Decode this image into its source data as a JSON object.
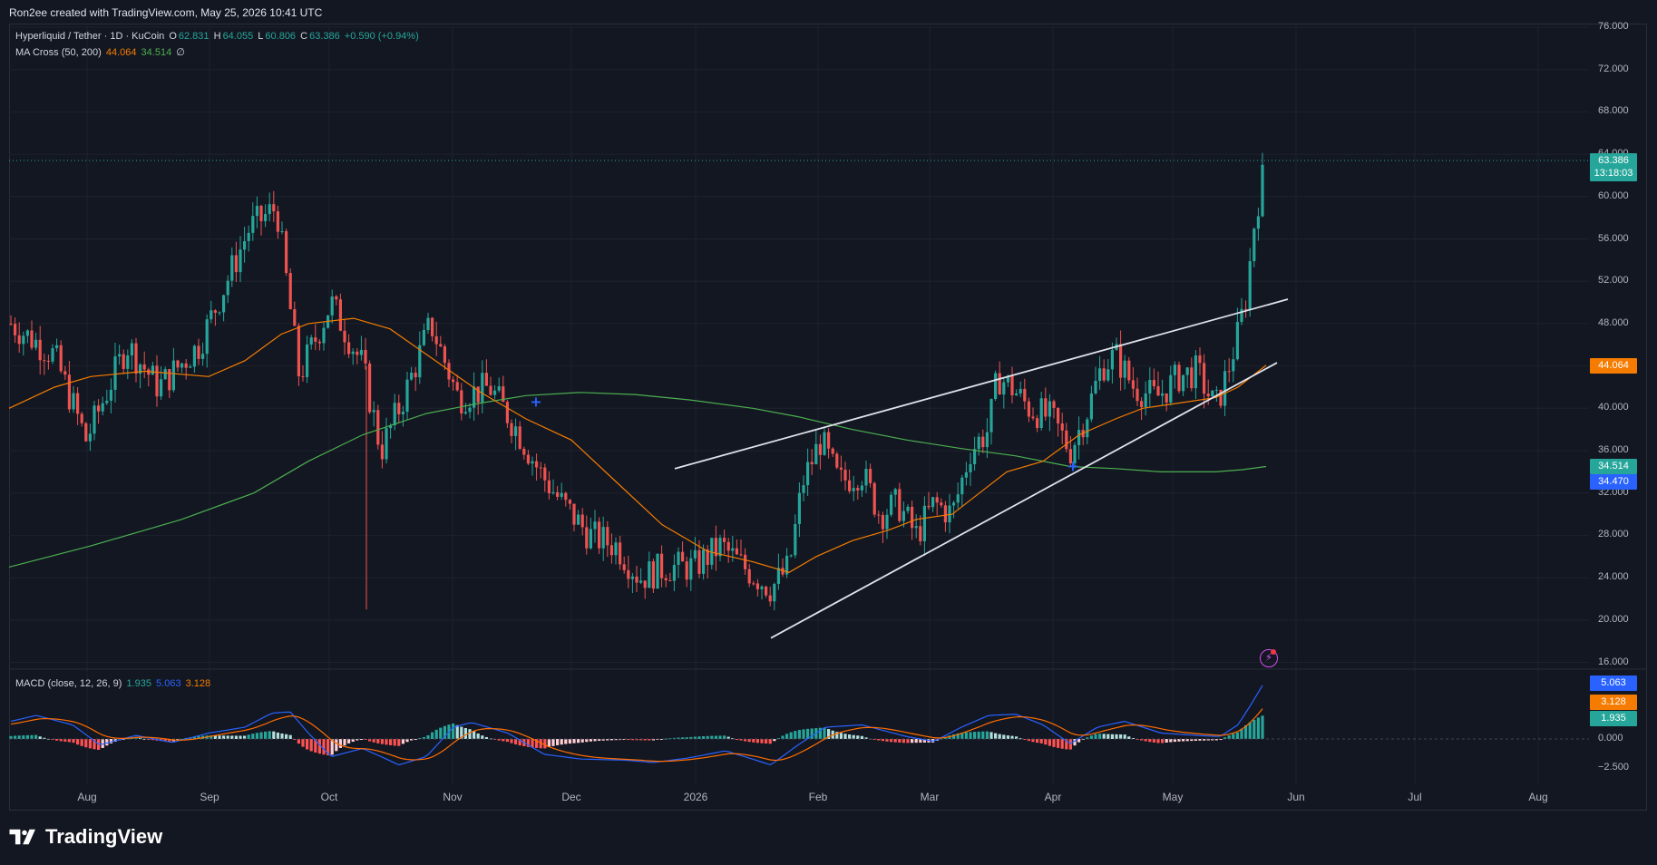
{
  "header": {
    "created_text": "Ron2ee created with TradingView.com, May 25, 2026 10:41 UTC"
  },
  "legend": {
    "symbol": "Hyperliquid / Tether · 1D · KuCoin",
    "open_label": "O",
    "open": "62.831",
    "high_label": "H",
    "high": "64.055",
    "low_label": "L",
    "low": "60.806",
    "close_label": "C",
    "close": "63.386",
    "change": "+0.590 (+0.94%)",
    "ma_name": "MA Cross (50, 200)",
    "ma_fast": "44.064",
    "ma_slow": "34.514",
    "ma_extra": "∅",
    "macd_name": "MACD (close, 12, 26, 9)",
    "macd_hist": "1.935",
    "macd_line": "5.063",
    "macd_signal": "3.128"
  },
  "price_axis": {
    "labels": [
      "76.000",
      "72.000",
      "68.000",
      "64.000",
      "60.000",
      "56.000",
      "52.000",
      "48.000",
      "44.000",
      "40.000",
      "36.000",
      "32.000",
      "28.000",
      "24.000",
      "20.000",
      "16.000"
    ]
  },
  "tags": {
    "last_price": "63.386",
    "countdown": "13:18:03",
    "ma_fast": "44.064",
    "ma_slow": "34.514",
    "cross_level": "34.470",
    "macd_line": "5.063",
    "macd_signal": "3.128",
    "macd_hist": "1.935"
  },
  "macd_axis": {
    "labels": [
      "0.000",
      "−2.500"
    ]
  },
  "time_axis": {
    "labels": [
      "Aug",
      "Sep",
      "Oct",
      "Nov",
      "Dec",
      "2026",
      "Feb",
      "Mar",
      "Apr",
      "May",
      "Jun",
      "Jul",
      "Aug"
    ]
  },
  "brand": {
    "name": "TradingView"
  },
  "colors": {
    "background": "#131722",
    "up": "#26a69a",
    "down": "#ef5350",
    "ma_fast": "#f57c00",
    "ma_slow": "#4caf50",
    "trendline": "#e0e3eb",
    "macd_line": "#2962ff",
    "signal_line": "#ff6d00"
  },
  "icons": {
    "flash": "lightning-icon",
    "cross_marker": "plus-marker-icon"
  }
}
